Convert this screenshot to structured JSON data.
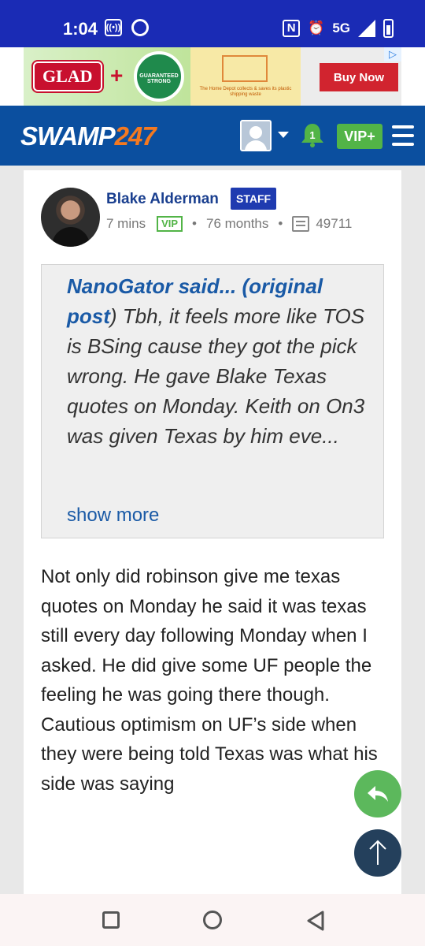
{
  "status_bar": {
    "time": "1:04",
    "network": "5G"
  },
  "ad": {
    "brand": "GLAD",
    "seal_text": "GUARANTEED STRONG",
    "partner_text": "The Home Depot collects & saves its plastic shipping waste",
    "cta_label": "Buy Now"
  },
  "header": {
    "logo_text": "SWAMP",
    "logo_number": "247",
    "notification_count": "1",
    "vip_label": "VIP+"
  },
  "post": {
    "author_name": "Blake Alderman",
    "staff_badge": "STAFF",
    "time_ago": "7 mins",
    "vip_tag": "VIP",
    "tenure": "76 months",
    "post_count": "49711",
    "quote": {
      "author": "NanoGator said...",
      "link_label": "(original post",
      "text": ") Tbh, it feels more like TOS is BSing cause they got the pick wrong. He gave Blake Texas quotes on Monday. Keith on On3 was given Texas by him eve...",
      "show_more_label": "show more"
    },
    "body": "Not only did robinson give me texas quotes on Monday he said it was texas still every day following Monday when I asked. He did give some UF people the feeling he was going there though. Cautious optimism on UF’s side when they were being told Texas was what his side was saying"
  },
  "colors": {
    "status_bar": "#1a2bb5",
    "header": "#0b4f9f",
    "accent_orange": "#f47920",
    "vip_green": "#52b447",
    "link_blue": "#1a5aa6"
  }
}
